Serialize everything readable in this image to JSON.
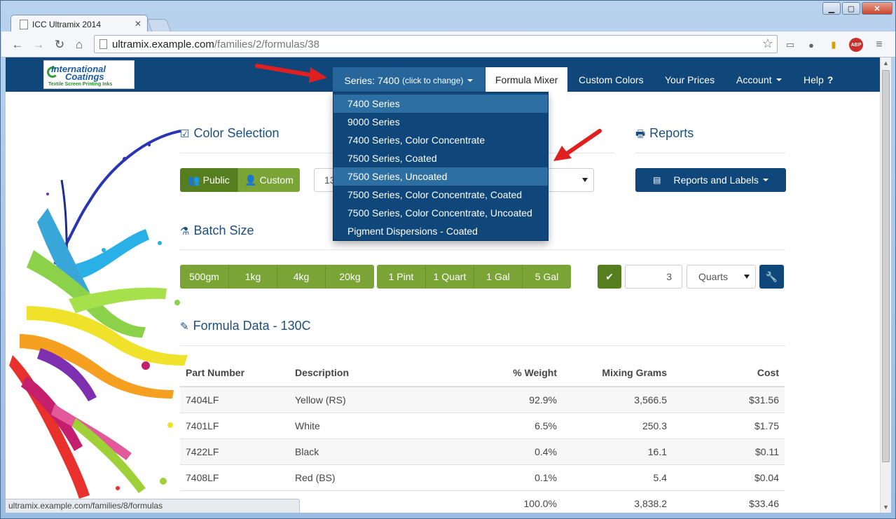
{
  "browser": {
    "tab_title": "ICC Ultramix 2014",
    "url_host": "ultramix.example.com",
    "url_path": "/families/2/formulas/38",
    "status_url": "ultramix.example.com/families/8/formulas"
  },
  "nav": {
    "series_label": "Series: 7400",
    "series_hint": "(click to change)",
    "formula_mixer": "Formula Mixer",
    "custom_colors": "Custom Colors",
    "your_prices": "Your Prices",
    "account": "Account",
    "help": "Help"
  },
  "logo": {
    "line1": "International",
    "line2": "Coatings",
    "line3": "Textile Screen Printing Inks"
  },
  "series_dropdown": [
    "7400 Series",
    "9000 Series",
    "7400 Series, Color Concentrate",
    "7500 Series, Coated",
    "7500 Series, Uncoated",
    "7500 Series, Color Concentrate, Coated",
    "7500 Series, Color Concentrate, Uncoated",
    "Pigment Dispersions - Coated"
  ],
  "color_selection": {
    "title": "Color Selection",
    "public": "Public",
    "custom": "Custom",
    "color_value_partial": "13"
  },
  "reports": {
    "title": "Reports",
    "button": "Reports and Labels"
  },
  "batch": {
    "title": "Batch Size",
    "metric": [
      "500gm",
      "1kg",
      "4kg",
      "20kg"
    ],
    "imperial": [
      "1 Pint",
      "1 Quart",
      "1 Gal",
      "5 Gal"
    ],
    "quantity": "3",
    "unit": "Quarts"
  },
  "formula": {
    "title": "Formula Data - 130C",
    "headers": [
      "Part Number",
      "Description",
      "% Weight",
      "Mixing Grams",
      "Cost"
    ],
    "rows": [
      [
        "7404LF",
        "Yellow (RS)",
        "92.9%",
        "3,566.5",
        "$31.56"
      ],
      [
        "7401LF",
        "White",
        "6.5%",
        "250.3",
        "$1.75"
      ],
      [
        "7422LF",
        "Black",
        "0.4%",
        "16.1",
        "$0.11"
      ],
      [
        "7408LF",
        "Red (BS)",
        "0.1%",
        "5.4",
        "$0.04"
      ]
    ],
    "totals": [
      "100.0%",
      "3,838.2",
      "$33.46"
    ]
  },
  "colors": {
    "nav_blue": "#0f477a",
    "accent_green": "#7aa435",
    "annotation_red": "#e02020"
  }
}
